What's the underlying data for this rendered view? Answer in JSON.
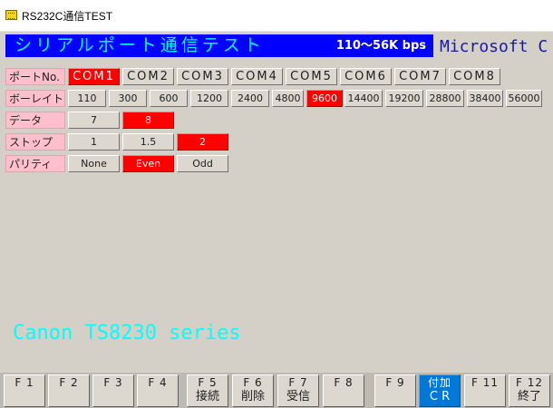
{
  "window": {
    "title": "RS232C通信TEST"
  },
  "header": {
    "title": "シリアルポート通信テスト",
    "speed": "110〜56K bps",
    "brand": "Microsoft C"
  },
  "settings": {
    "port": {
      "label": "ポートNo.",
      "options": [
        "COM1",
        "COM2",
        "COM3",
        "COM4",
        "COM5",
        "COM6",
        "COM7",
        "COM8"
      ],
      "selected": "COM1"
    },
    "baud": {
      "label": "ボーレイト",
      "options": [
        "110",
        "300",
        "600",
        "1200",
        "2400",
        "4800",
        "9600",
        "14400",
        "19200",
        "28800",
        "38400",
        "56000"
      ],
      "selected": "9600"
    },
    "data": {
      "label": "データ",
      "options": [
        "7",
        "8"
      ],
      "selected": "8"
    },
    "stop": {
      "label": "ストップ",
      "options": [
        "1",
        "1.5",
        "2"
      ],
      "selected": "2"
    },
    "parity": {
      "label": "パリティ",
      "options": [
        "None",
        "Even",
        "Odd"
      ],
      "selected": "Even"
    }
  },
  "status": {
    "printer": "Canon TS8230 series"
  },
  "function_keys": [
    {
      "key": "F 1",
      "label": ""
    },
    {
      "key": "F 2",
      "label": ""
    },
    {
      "key": "F 3",
      "label": ""
    },
    {
      "key": "F 4",
      "label": ""
    },
    {
      "key": "F 5",
      "label": "接続"
    },
    {
      "key": "F 6",
      "label": "削除"
    },
    {
      "key": "F 7",
      "label": "受信"
    },
    {
      "key": "F 8",
      "label": ""
    },
    {
      "key": "F 9",
      "label": ""
    },
    {
      "key": "付加",
      "label": "C R"
    },
    {
      "key": "F 11",
      "label": ""
    },
    {
      "key": "F 12",
      "label": "終了"
    }
  ],
  "active_function_key": "付加",
  "colors": {
    "header_bg": "#0000ff",
    "header_text": "#00ffff",
    "selected": "#ff0000",
    "label_bg": "#ffc0cb",
    "active_key": "#0078d7"
  }
}
